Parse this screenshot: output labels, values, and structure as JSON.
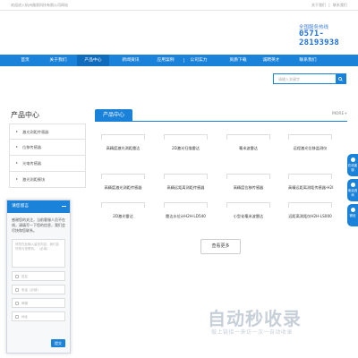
{
  "topbar": {
    "welcome": "欢迎进入杭州路晋科技有限公司网站",
    "links": [
      "关于我们",
      "|",
      "联系我们"
    ]
  },
  "header": {
    "hotline_label": "全国服务热线",
    "hotline_number": "0571-28193938"
  },
  "nav": {
    "items": [
      "首页",
      "关于我们",
      "产品中心",
      "新闻资讯",
      "应用案例",
      "公司实力",
      "资质下载",
      "诚聘英才",
      "联系我们"
    ],
    "active_index": 2
  },
  "search": {
    "placeholder": "请输入关键字"
  },
  "sidebar": {
    "title": "产品中心",
    "items": [
      "激光测距传感器",
      "位移传感器",
      "光电传感器",
      "激光测距模块"
    ]
  },
  "products": {
    "tab_label": "产品中心",
    "more_label": "MORE+",
    "items": [
      "高精度激光测距雷达",
      "2D激光扫描雷达",
      "毫米波雷达",
      "远程激光位移监测仪",
      "高精度激光测距传感器",
      "高精远距离测距传感器",
      "高精度位移传感器",
      "高精远距离测距传感器-H2I",
      "2D激光雷达",
      "雷达水位计H2H-LD540",
      "小型化毫米波雷达",
      "远距离测距仪H2H-LS000"
    ],
    "view_more": "查看更多"
  },
  "floating": {
    "items": [
      "在线客服",
      "电话咨询",
      "微信"
    ]
  },
  "chat": {
    "title": "请您留言",
    "message": "感谢您的关注，当前客服人员不在线，请填写一下您的信息，我们会尽快和您联系。",
    "textarea_placeholder": "请您在此输入留言内容，我们会尽快与您联系。（必填）",
    "fields": [
      "姓名",
      "电话（必填）",
      "邮箱",
      "地址"
    ],
    "send_label": "提交"
  },
  "watermark": {
    "logo_text": "自动秒收录",
    "sub_text": "做上链接一来访一次一自动收录"
  },
  "colors": {
    "primary": "#1a82d8",
    "nav_active": "#0f6bbb",
    "hotline": "#1f6fd8"
  }
}
